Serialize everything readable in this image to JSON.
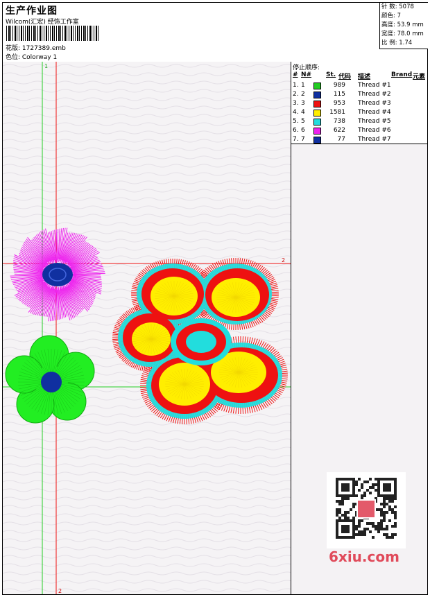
{
  "header": {
    "title": "生产作业图",
    "studio": "Wilcom(汇宏) 经饰工作室",
    "design": "花版: 1727389.emb",
    "colorway": "色位: Colorway 1"
  },
  "stats": [
    "针 数: 5078",
    "颜色: 7",
    "高度: 53.9 mm",
    "宽度: 78.0 mm",
    "比 例: 1.74"
  ],
  "stop_panel": {
    "title": "停止顺序:",
    "columns": [
      "#",
      "N#",
      "St.",
      "代码",
      "描述",
      "Brand",
      "元素"
    ],
    "rows": [
      {
        "idx": "1.",
        "n": "1",
        "color": "#22cc22",
        "code": "989",
        "desc": "Thread #1"
      },
      {
        "idx": "2.",
        "n": "2",
        "color": "#1030a0",
        "code": "115",
        "desc": "Thread #2"
      },
      {
        "idx": "3.",
        "n": "3",
        "color": "#ee1111",
        "code": "953",
        "desc": "Thread #3"
      },
      {
        "idx": "4.",
        "n": "4",
        "color": "#ffee00",
        "code": "1581",
        "desc": "Thread #4"
      },
      {
        "idx": "5.",
        "n": "5",
        "color": "#22dddd",
        "code": "738",
        "desc": "Thread #5"
      },
      {
        "idx": "6.",
        "n": "6",
        "color": "#ee22ee",
        "code": "622",
        "desc": "Thread #6"
      },
      {
        "idx": "7.",
        "n": "7",
        "color": "#1030a0",
        "code": "77",
        "desc": "Thread #7"
      }
    ]
  },
  "markers": {
    "v1": "1",
    "h2": "2",
    "v2": "2"
  },
  "watermark": "6xiu.com"
}
